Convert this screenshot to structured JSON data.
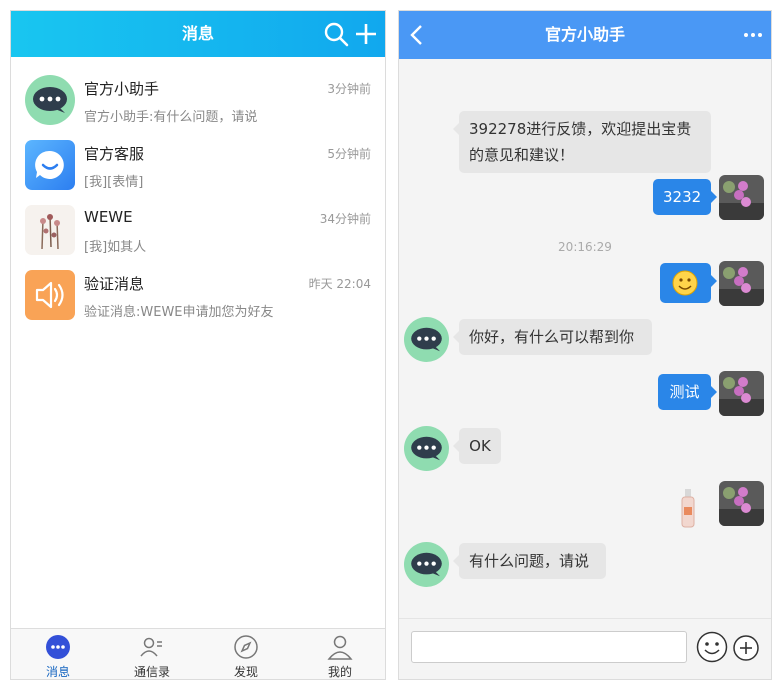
{
  "left": {
    "header": {
      "title": "消息"
    },
    "conversations": [
      {
        "name": "官方小助手",
        "time": "3分钟前",
        "preview": "官方小助手:有什么问题，请说",
        "avatar": "chat-bubble-avatar"
      },
      {
        "name": "官方客服",
        "time": "5分钟前",
        "preview": "[我][表情]",
        "avatar": "service-avatar"
      },
      {
        "name": "WEWE",
        "time": "34分钟前",
        "preview": "[我]如其人",
        "avatar": "photo-avatar"
      },
      {
        "name": "验证消息",
        "time": "昨天 22:04",
        "preview": "验证消息:WEWE申请加您为好友",
        "avatar": "speaker-avatar"
      }
    ],
    "tabs": [
      {
        "label": "消息",
        "icon": "message-icon",
        "active": true
      },
      {
        "label": "通信录",
        "icon": "contacts-icon",
        "active": false
      },
      {
        "label": "发现",
        "icon": "compass-icon",
        "active": false
      },
      {
        "label": "我的",
        "icon": "user-icon",
        "active": false
      }
    ]
  },
  "right": {
    "header": {
      "title": "官方小助手"
    },
    "messages": [
      {
        "from": "assistant",
        "text": "392278进行反馈，欢迎提出宝贵的意见和建议！"
      },
      {
        "from": "me",
        "text": "3232"
      },
      {
        "type": "timestamp",
        "text": "20:16:29"
      },
      {
        "from": "me",
        "type": "emoji"
      },
      {
        "from": "assistant",
        "text": "你好，有什么可以帮到你"
      },
      {
        "from": "me",
        "text": "测试"
      },
      {
        "from": "assistant",
        "text": "OK"
      },
      {
        "from": "me",
        "type": "image"
      },
      {
        "from": "assistant",
        "text": "有什么问题，请说"
      }
    ],
    "input": {
      "placeholder": ""
    }
  },
  "colors": {
    "left_header": "#11a8ee",
    "right_header": "#4a98f5",
    "out_bubble": "#2a86e8",
    "avatar_green": "#8fdcb0"
  }
}
